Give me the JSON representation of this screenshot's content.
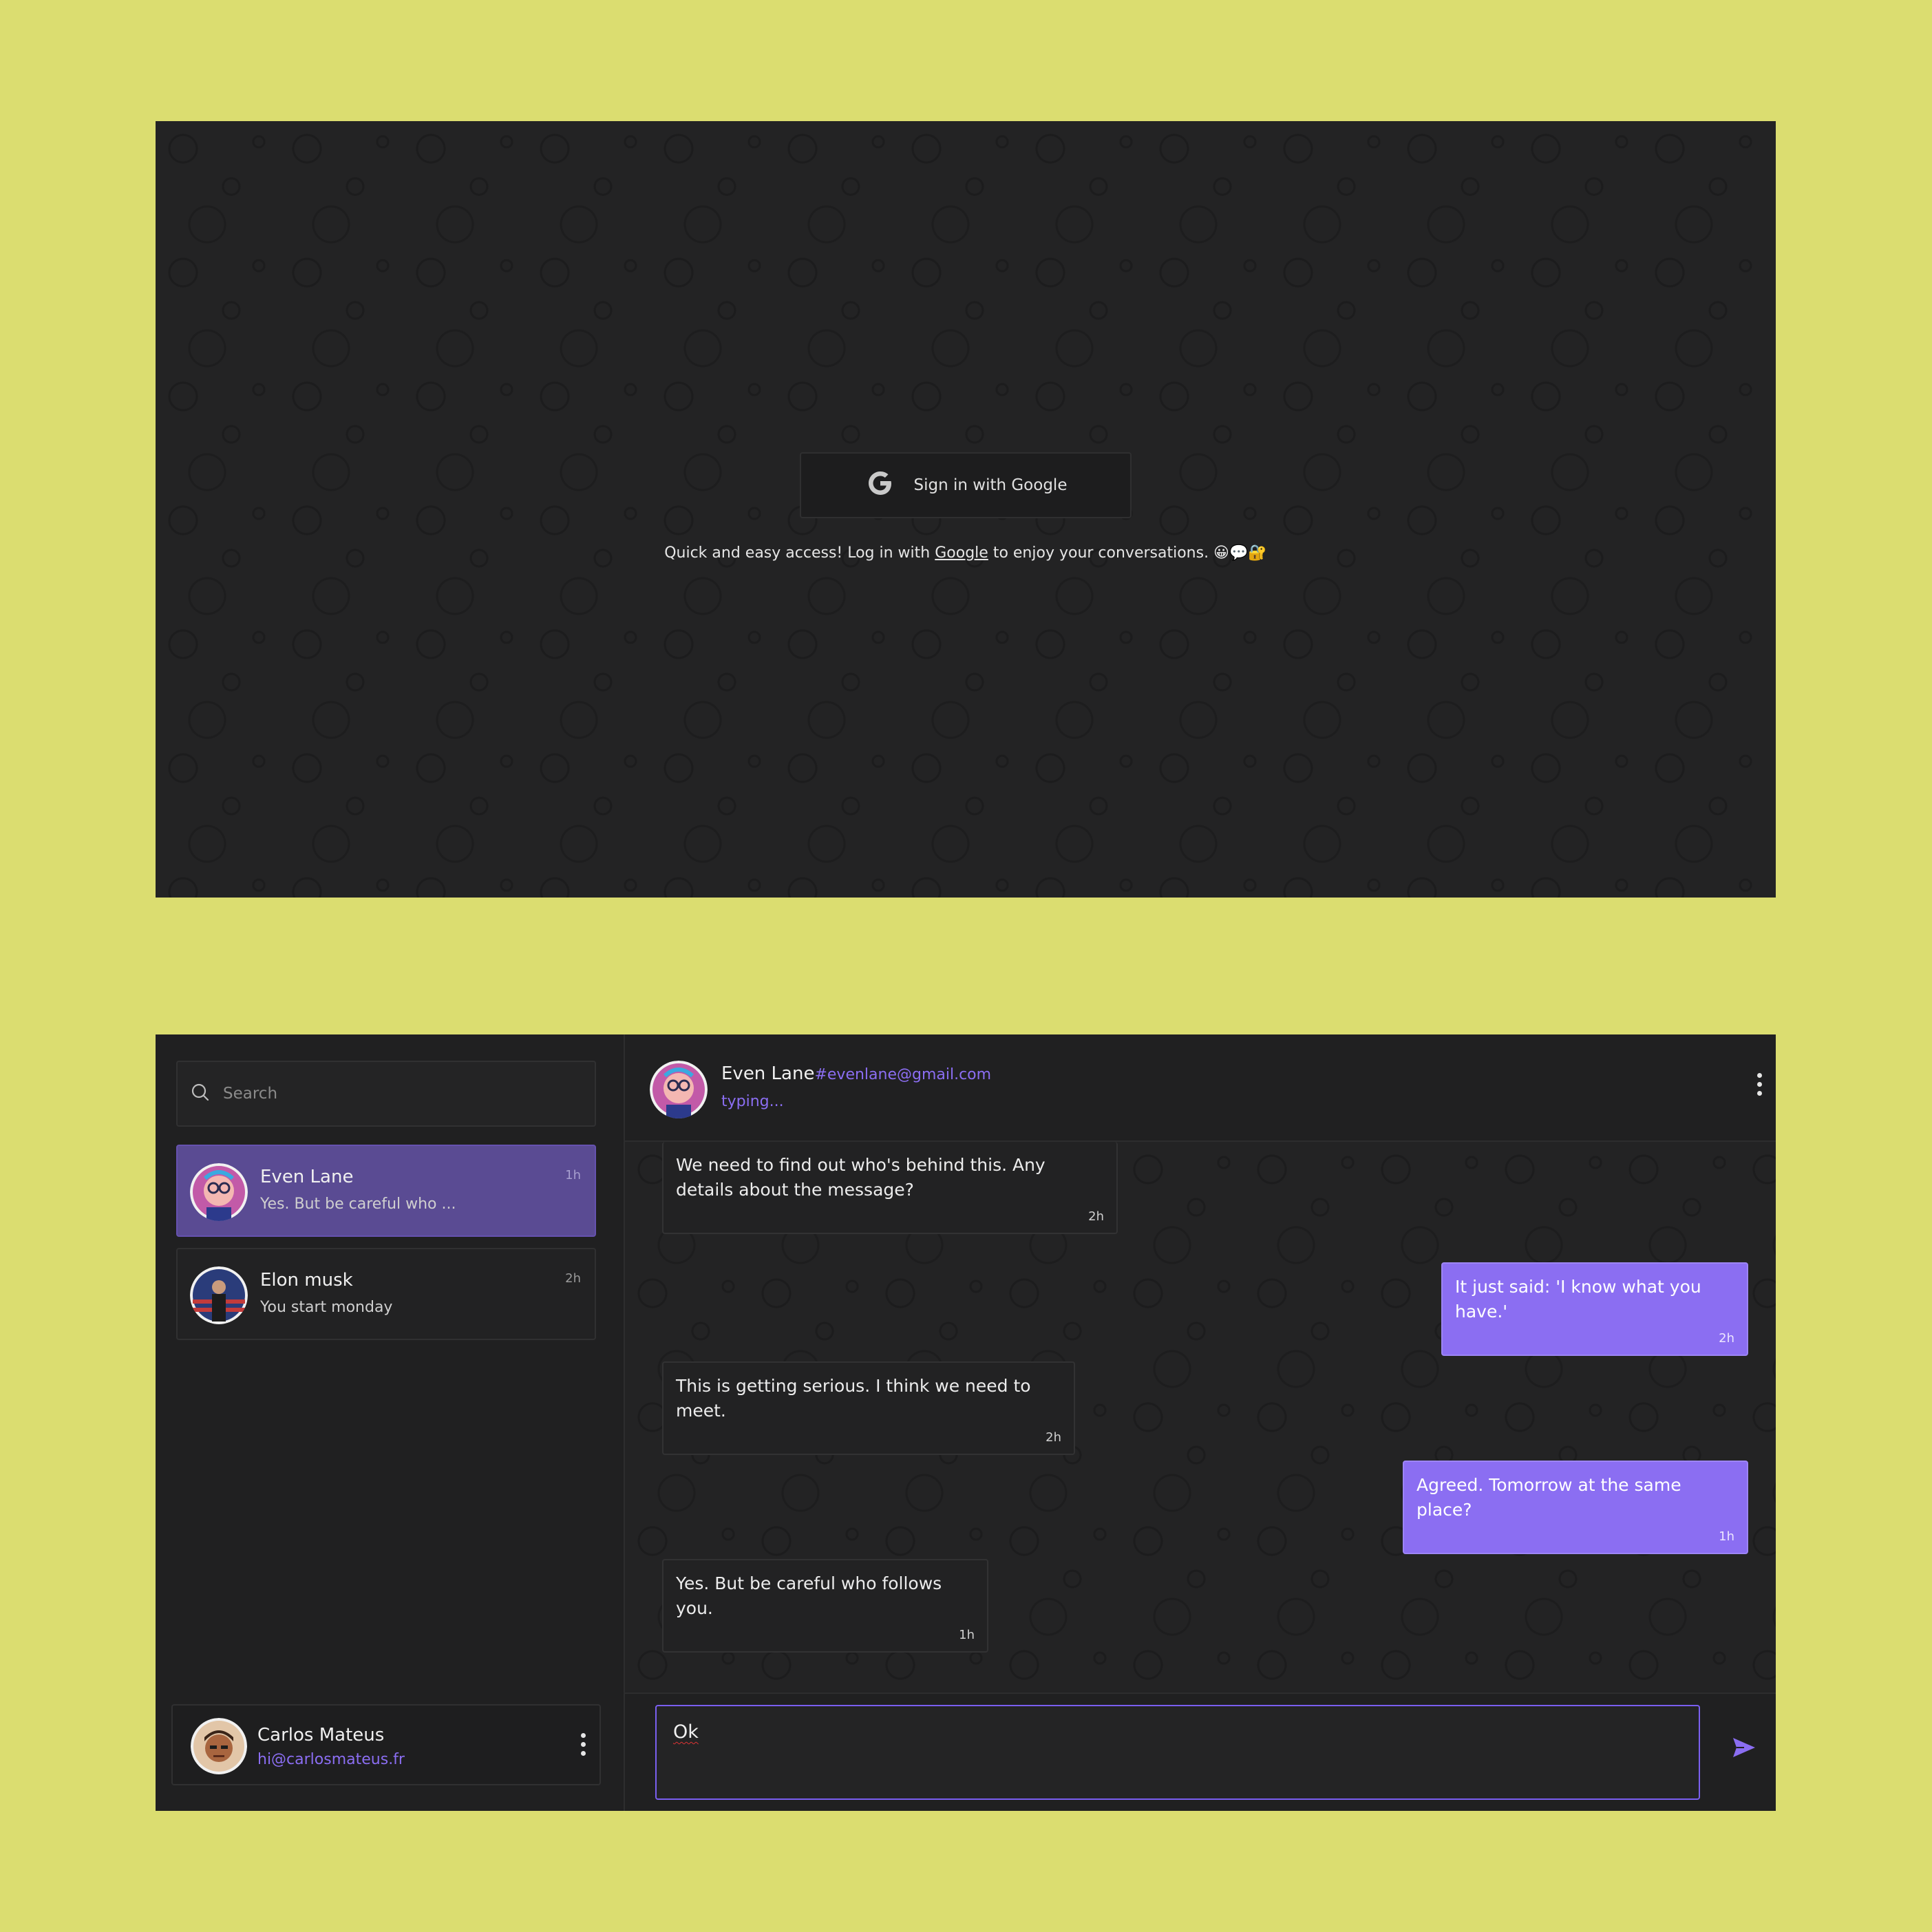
{
  "login": {
    "google_button_label": "Sign in with Google",
    "tagline_before": "Quick and easy access! Log in with ",
    "tagline_link": "Google",
    "tagline_after": " to enjoy your conversations. 😀💬🔐"
  },
  "sidebar": {
    "search_placeholder": "Search",
    "contacts": [
      {
        "name": "Even Lane",
        "preview": "Yes. But be careful who ...",
        "time": "1h",
        "active": true
      },
      {
        "name": "Elon musk",
        "preview": "You start monday",
        "time": "2h",
        "active": false
      }
    ],
    "current_user": {
      "name": "Carlos Mateus",
      "email": "hi@carlosmateus.fr"
    }
  },
  "chat": {
    "contact_name": "Even Lane",
    "contact_email": "#evenlane@gmail.com",
    "status": "typing...",
    "messages": [
      {
        "direction": "in",
        "text": "We need to find out who's behind this. Any details about the message?",
        "time": "2h"
      },
      {
        "direction": "out",
        "text": "It just said: 'I know what you have.'",
        "time": "2h"
      },
      {
        "direction": "in",
        "text": "This is getting serious. I think we need to meet.",
        "time": "2h"
      },
      {
        "direction": "out",
        "text": "Agreed. Tomorrow at the same place?",
        "time": "1h"
      },
      {
        "direction": "in",
        "text": "Yes. But be careful who follows you.",
        "time": "1h"
      }
    ],
    "composer_value": "Ok"
  },
  "colors": {
    "page_background": "#dbdd70",
    "panel_background": "#232324",
    "accent": "#8b6ef2",
    "active_contact": "#5a4b93"
  },
  "icons": [
    "google-icon",
    "search-icon",
    "kebab-menu-icon",
    "send-icon"
  ]
}
